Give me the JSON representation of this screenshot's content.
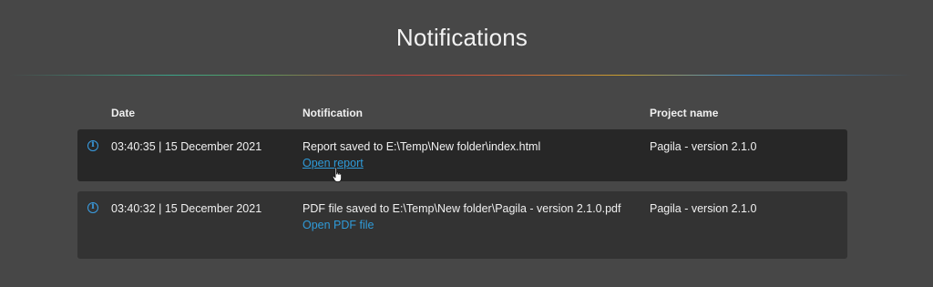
{
  "page": {
    "title": "Notifications"
  },
  "table": {
    "headers": {
      "date": "Date",
      "notification": "Notification",
      "project": "Project name"
    },
    "rows": [
      {
        "icon": "info-icon",
        "date": "03:40:35 | 15 December 2021",
        "message": "Report saved to E:\\Temp\\New folder\\index.html",
        "link": "Open report",
        "project": "Pagila - version 2.1.0"
      },
      {
        "icon": "info-icon",
        "date": "03:40:32 | 15 December 2021",
        "message": "PDF file saved to E:\\Temp\\New folder\\Pagila - version 2.1.0.pdf",
        "link": "Open PDF file",
        "project": "Pagila - version 2.1.0"
      }
    ]
  },
  "colors": {
    "background": "#474747",
    "row_background": "#2a2a2a",
    "accent": "#2f9bd9"
  }
}
